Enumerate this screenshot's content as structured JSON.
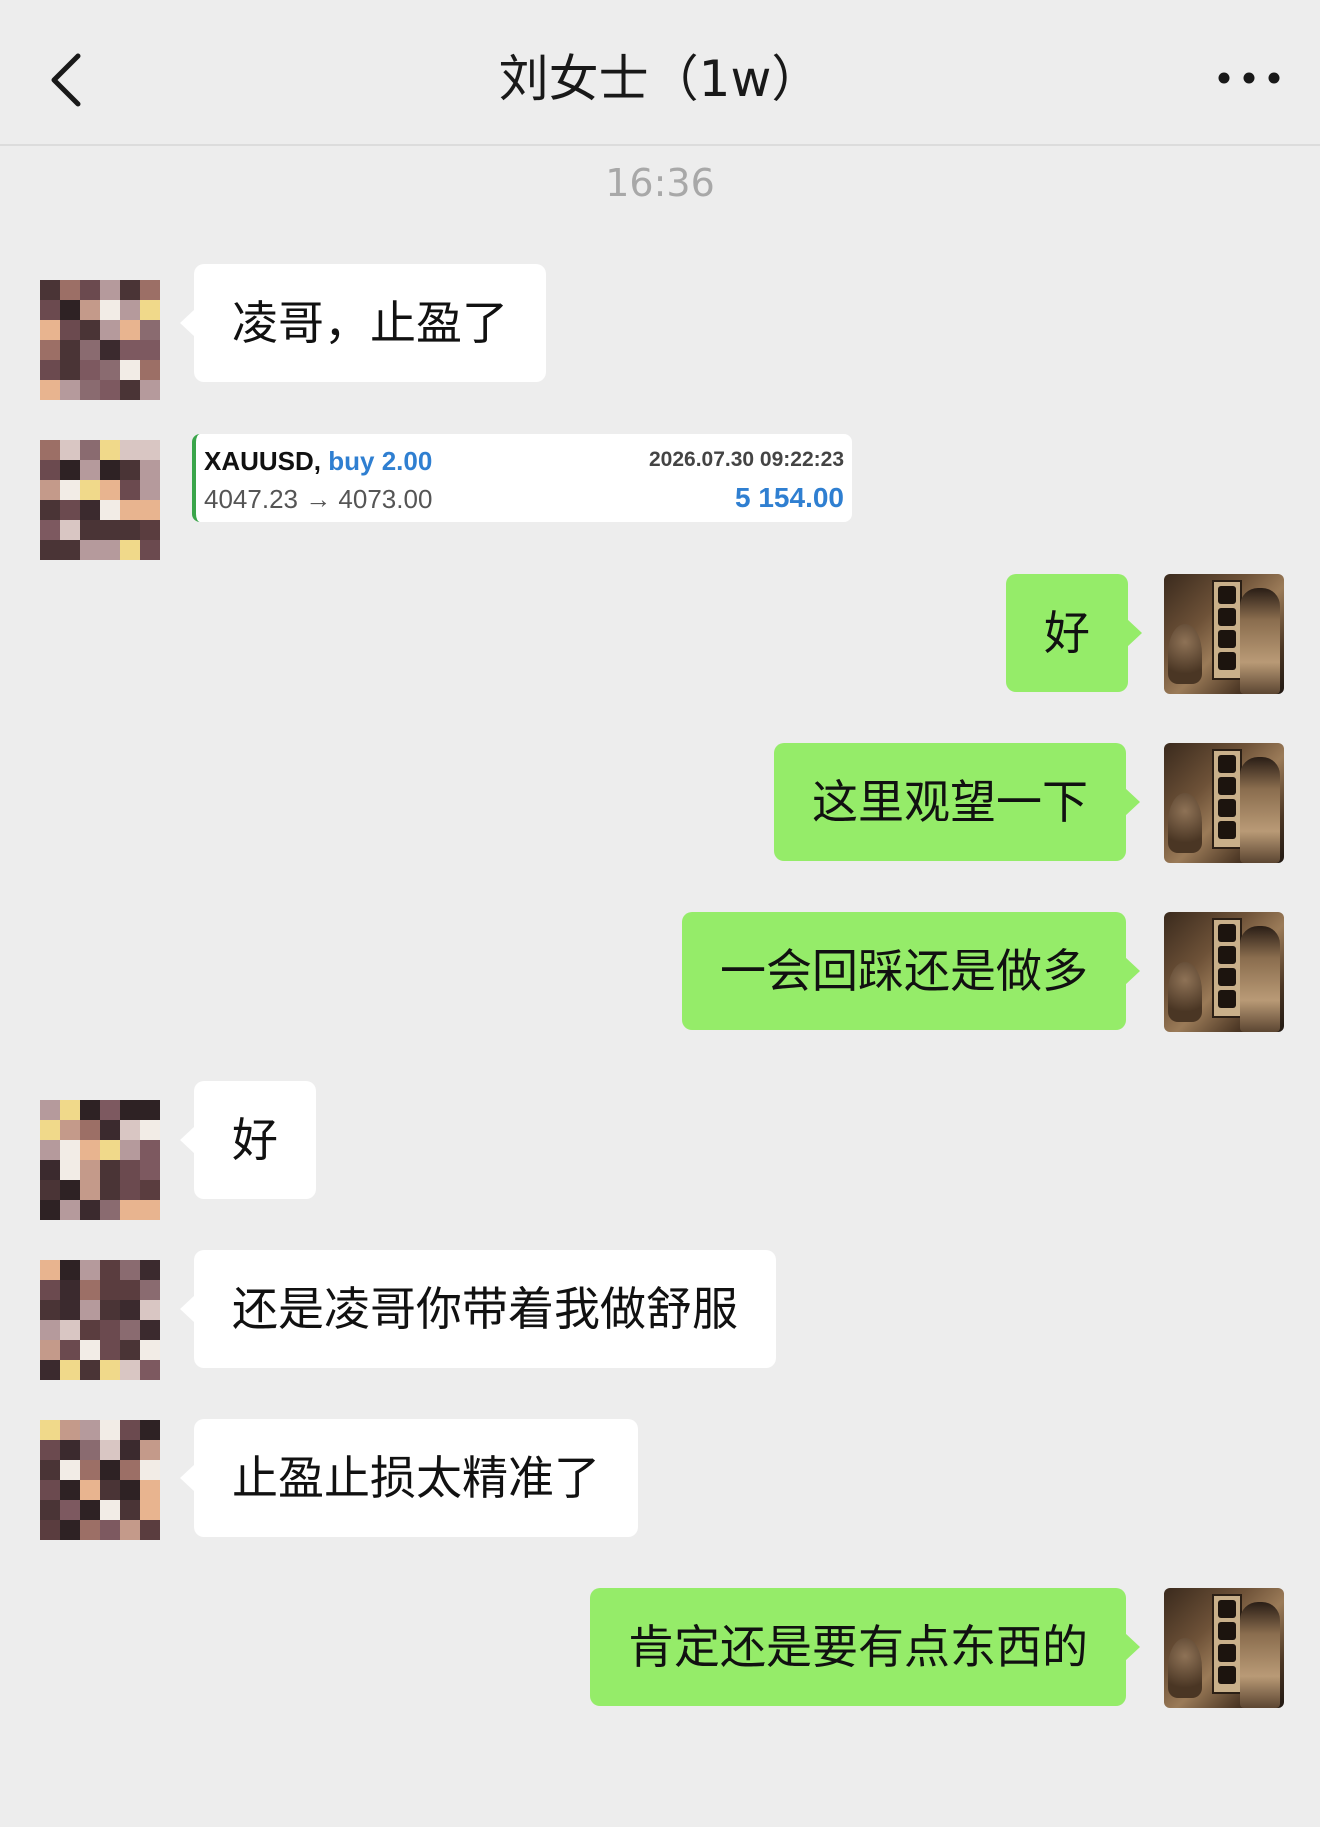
{
  "header": {
    "title": "刘女士（1w）",
    "back_icon": "chevron-left-icon",
    "more_icon": "more-dots-icon"
  },
  "timestamp": "16:36",
  "messages": [
    {
      "from": "contact",
      "text": "凌哥，止盈了"
    },
    {
      "from": "contact",
      "type": "trade_card",
      "symbol": "XAUUSD,",
      "side": "buy 2.00",
      "datetime": "2026.07.30 09:22:23",
      "prices": "4047.23 → 4073.00",
      "profit": "5 154.00"
    },
    {
      "from": "me",
      "text": "好"
    },
    {
      "from": "me",
      "text": "这里观望一下"
    },
    {
      "from": "me",
      "text": "一会回踩还是做多"
    },
    {
      "from": "contact",
      "text": "好"
    },
    {
      "from": "contact",
      "text": "还是凌哥你带着我做舒服"
    },
    {
      "from": "contact",
      "text": "止盈止损太精准了"
    },
    {
      "from": "me",
      "text": "肯定还是要有点东西的"
    }
  ],
  "colors": {
    "background": "#ededed",
    "incoming_bubble": "#ffffff",
    "outgoing_bubble": "#95ec69",
    "trade_accent": "#2f7fd1"
  }
}
